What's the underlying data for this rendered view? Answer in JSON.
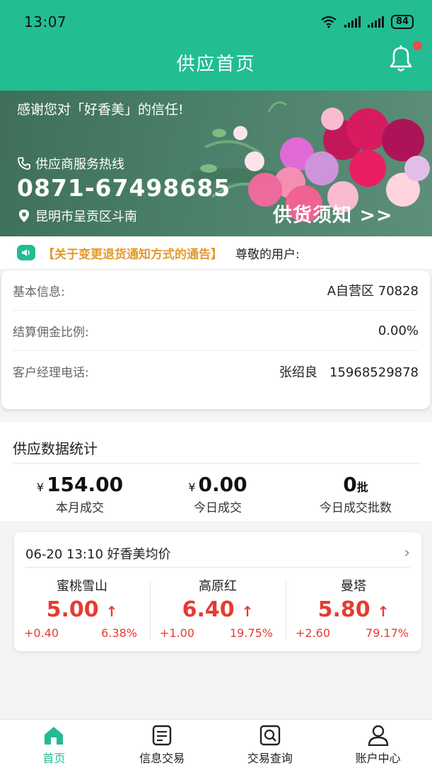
{
  "statusbar": {
    "time": "13:07",
    "battery": "84"
  },
  "header": {
    "title": "供应首页"
  },
  "banner": {
    "thanks": "感谢您对「好香美」的信任!",
    "hotline_label": "供应商服务热线",
    "phone": "0871-67498685",
    "address": "昆明市呈贡区斗南",
    "notice_link": "供货须知 >>"
  },
  "announcement": {
    "title": "【关于变更退货通知方式的通告】",
    "text": "尊敬的用户:"
  },
  "info": {
    "rows": [
      {
        "label": "基本信息:",
        "value": "A自营区 70828"
      },
      {
        "label": "结算佣金比例:",
        "value": "0.00%"
      },
      {
        "label": "客户经理电话:",
        "value": "张绍良   15968529878"
      }
    ]
  },
  "stats": {
    "title": "供应数据统计",
    "items": [
      {
        "currency": "¥",
        "value": "154.00",
        "unit": "",
        "label": "本月成交"
      },
      {
        "currency": "¥",
        "value": "0.00",
        "unit": "",
        "label": "今日成交"
      },
      {
        "currency": "",
        "value": "0",
        "unit": "批",
        "label": "今日成交批数"
      }
    ]
  },
  "price_card": {
    "header": "06-20 13:10 好香美均价",
    "items": [
      {
        "name": "蜜桃雪山",
        "price": "5.00",
        "arrow": "↑",
        "change": "+0.40",
        "percent": "6.38%"
      },
      {
        "name": "高原红",
        "price": "6.40",
        "arrow": "↑",
        "change": "+1.00",
        "percent": "19.75%"
      },
      {
        "name": "曼塔",
        "price": "5.80",
        "arrow": "↑",
        "change": "+2.60",
        "percent": "79.17%"
      }
    ]
  },
  "nav": {
    "items": [
      {
        "label": "首页",
        "icon": "home-icon"
      },
      {
        "label": "信息交易",
        "icon": "document-icon"
      },
      {
        "label": "交易查询",
        "icon": "search-doc-icon"
      },
      {
        "label": "账户中心",
        "icon": "user-icon"
      }
    ]
  },
  "colors": {
    "brand": "#22bd93",
    "price_up": "#e53b32",
    "notice": "#e39a2a",
    "badge": "#f04a4a"
  }
}
